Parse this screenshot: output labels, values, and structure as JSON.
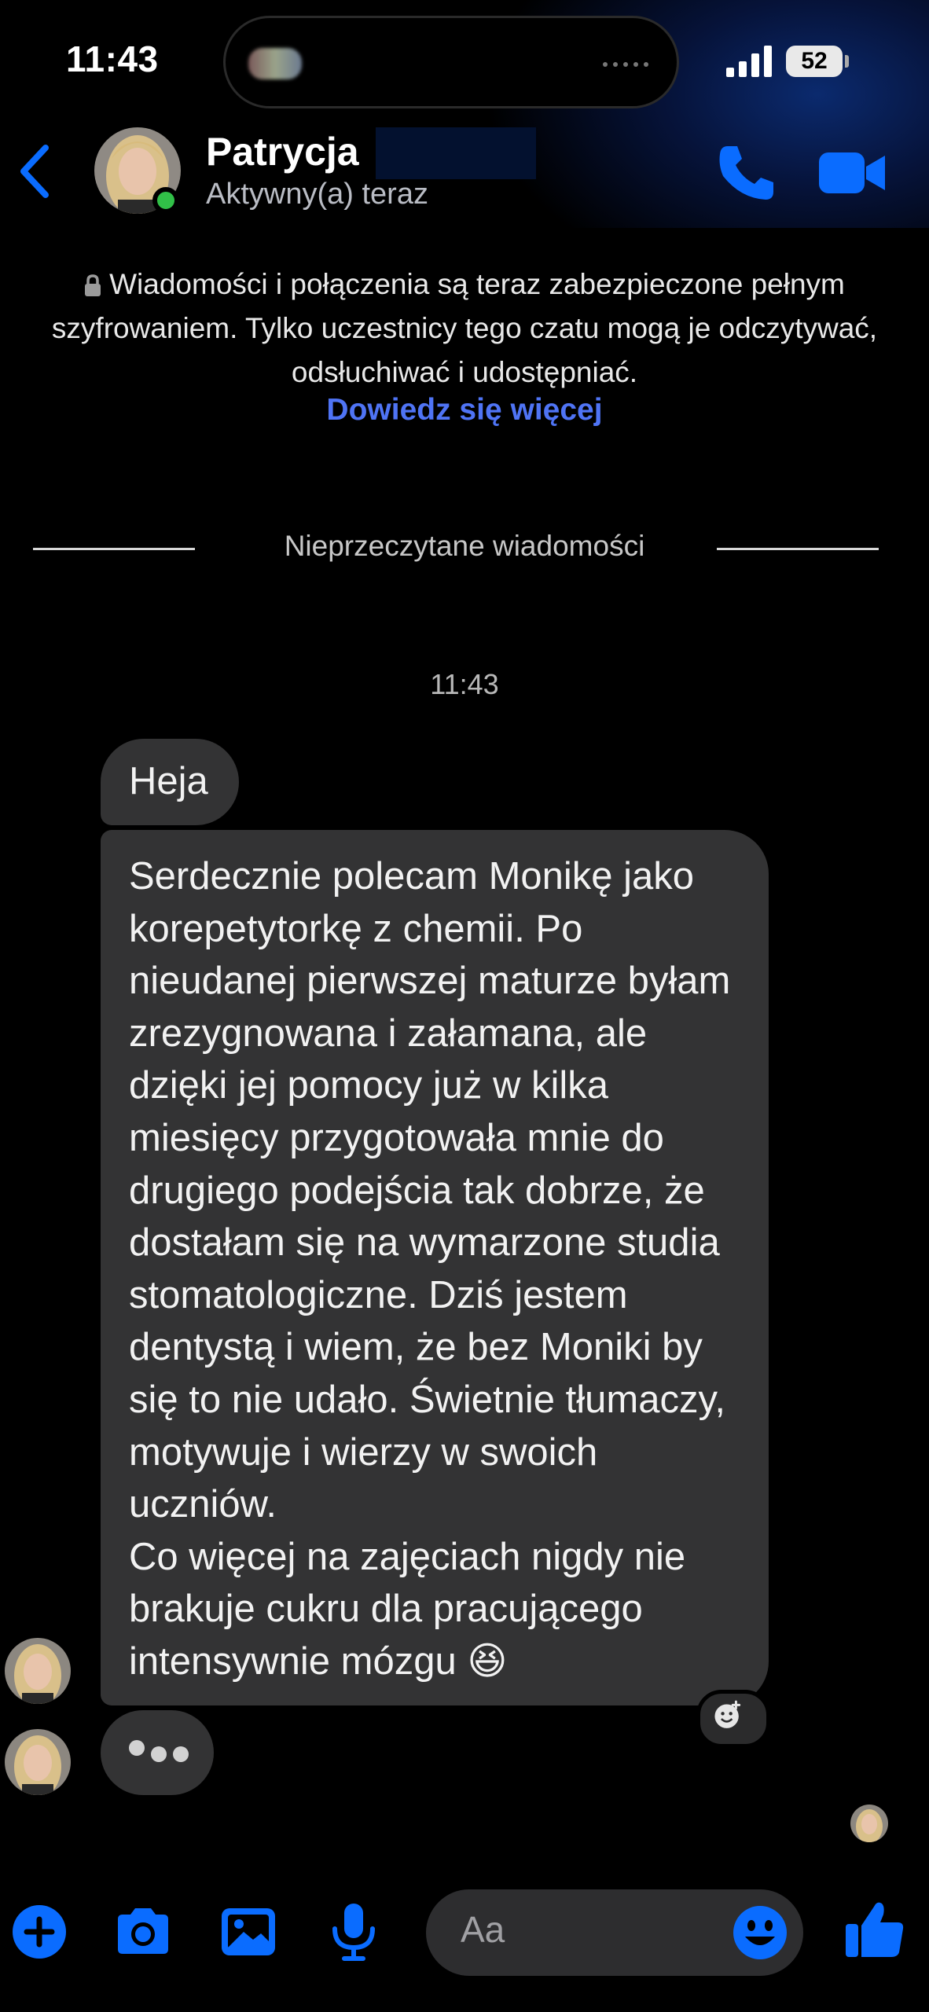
{
  "colors": {
    "accent": "#0a6cff",
    "link": "#4f74f5",
    "bubble": "#333334",
    "online": "#31c048"
  },
  "status_bar": {
    "time": "11:43",
    "battery": "52",
    "icons": [
      "signal-icon",
      "battery-icon"
    ]
  },
  "header": {
    "contact_name": "Patrycja",
    "presence": "Aktywny(a) teraz",
    "icons": [
      "back-icon",
      "phone-icon",
      "video-camera-icon"
    ]
  },
  "notice": {
    "text": "Wiadomości i połączenia są teraz zabezpieczone pełnym szyfrowaniem. Tylko uczestnicy tego czatu mogą je odczytywać, odsłuchiwać i udostępniać.",
    "link": "Dowiedz się więcej"
  },
  "divider": {
    "label": "Nieprzeczytane wiadomości"
  },
  "timestamp": "11:43",
  "messages": [
    {
      "text": "Heja"
    },
    {
      "text": "Serdecznie polecam Monikę jako korepetytorkę z chemii. Po nieudanej pierwszej maturze byłam zrezygnowana i załamana, ale dzięki jej pomocy już w kilka miesięcy przygotowała mnie do drugiego podejścia tak dobrze, że dostałam się na wymarzone studia stomatologiczne. Dziś jestem dentystą i wiem, że bez Moniki by się to nie udało. Świetnie tłumaczy, motywuje i wierzy w swoich uczniów.\nCo więcej  na zajęciach nigdy nie brakuje cukru dla pracującego intensywnie mózgu 😆"
    }
  ],
  "composer": {
    "placeholder": "Aa",
    "icons": [
      "plus-icon",
      "camera-icon",
      "gallery-icon",
      "microphone-icon",
      "emoji-icon",
      "thumbs-up-icon"
    ]
  }
}
